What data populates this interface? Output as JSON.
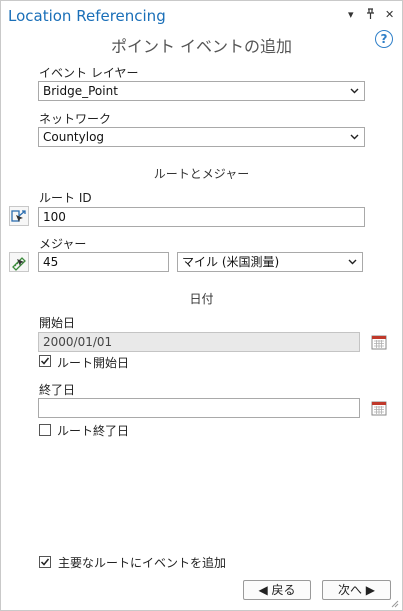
{
  "window": {
    "title": "Location Referencing",
    "subtitle": "ポイント イベントの追加",
    "menu_glyph": "▾",
    "pin_glyph": "ᵖ",
    "close_glyph": "✕",
    "help_glyph": "?"
  },
  "event_layer": {
    "label": "イベント レイヤー",
    "value": "Bridge_Point"
  },
  "network": {
    "label": "ネットワーク",
    "value": "Countylog"
  },
  "route_measure": {
    "section_label": "ルートとメジャー",
    "route_id_label": "ルート ID",
    "route_id_value": "100",
    "measure_label": "メジャー",
    "measure_value": "45",
    "unit_value": "マイル (米国測量)"
  },
  "date": {
    "section_label": "日付",
    "start_label": "開始日",
    "start_value": "2000/01/01",
    "route_start_label": "ルート開始日",
    "route_start_checked": true,
    "end_label": "終了日",
    "end_value": "",
    "route_end_label": "ルート終了日",
    "route_end_checked": false
  },
  "footer": {
    "add_to_dominant_label": "主要なルートにイベントを追加",
    "add_to_dominant_checked": true,
    "back_label": "◀ 戻る",
    "next_label": "次へ ▶"
  },
  "colors": {
    "title": "#1a6fb8",
    "help": "#2f7fc8",
    "calendar": "#c0392b"
  }
}
